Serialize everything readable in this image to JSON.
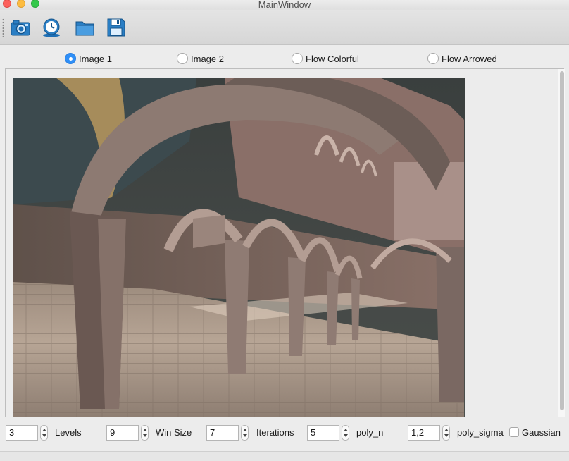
{
  "window": {
    "title": "MainWindow"
  },
  "toolbar": {
    "buttons": [
      {
        "icon": "camera-icon"
      },
      {
        "icon": "clock-icon"
      },
      {
        "icon": "folder-icon"
      },
      {
        "icon": "floppy-disk-icon"
      }
    ]
  },
  "view_options": {
    "selected": "Image 1",
    "items": [
      {
        "label": "Image 1",
        "checked": true
      },
      {
        "label": "Image 2",
        "checked": false
      },
      {
        "label": "Flow Colorful",
        "checked": false
      },
      {
        "label": "Flow Arrowed",
        "checked": false
      }
    ]
  },
  "image": {
    "content": "courtyard with arches rendering"
  },
  "params": {
    "levels": {
      "value": "3",
      "label": "Levels"
    },
    "win_size": {
      "value": "9",
      "label": "Win Size"
    },
    "iterations": {
      "value": "7",
      "label": "Iterations"
    },
    "poly_n": {
      "value": "5",
      "label": "poly_n"
    },
    "poly_sigma": {
      "value": "1,2",
      "label": "poly_sigma"
    },
    "gaussian": {
      "label": "Gaussian",
      "checked": false
    }
  },
  "colors": {
    "accent": "#2f8ff7",
    "toolbar_icon": "#1e6fb5",
    "window_bg": "#ececec"
  }
}
